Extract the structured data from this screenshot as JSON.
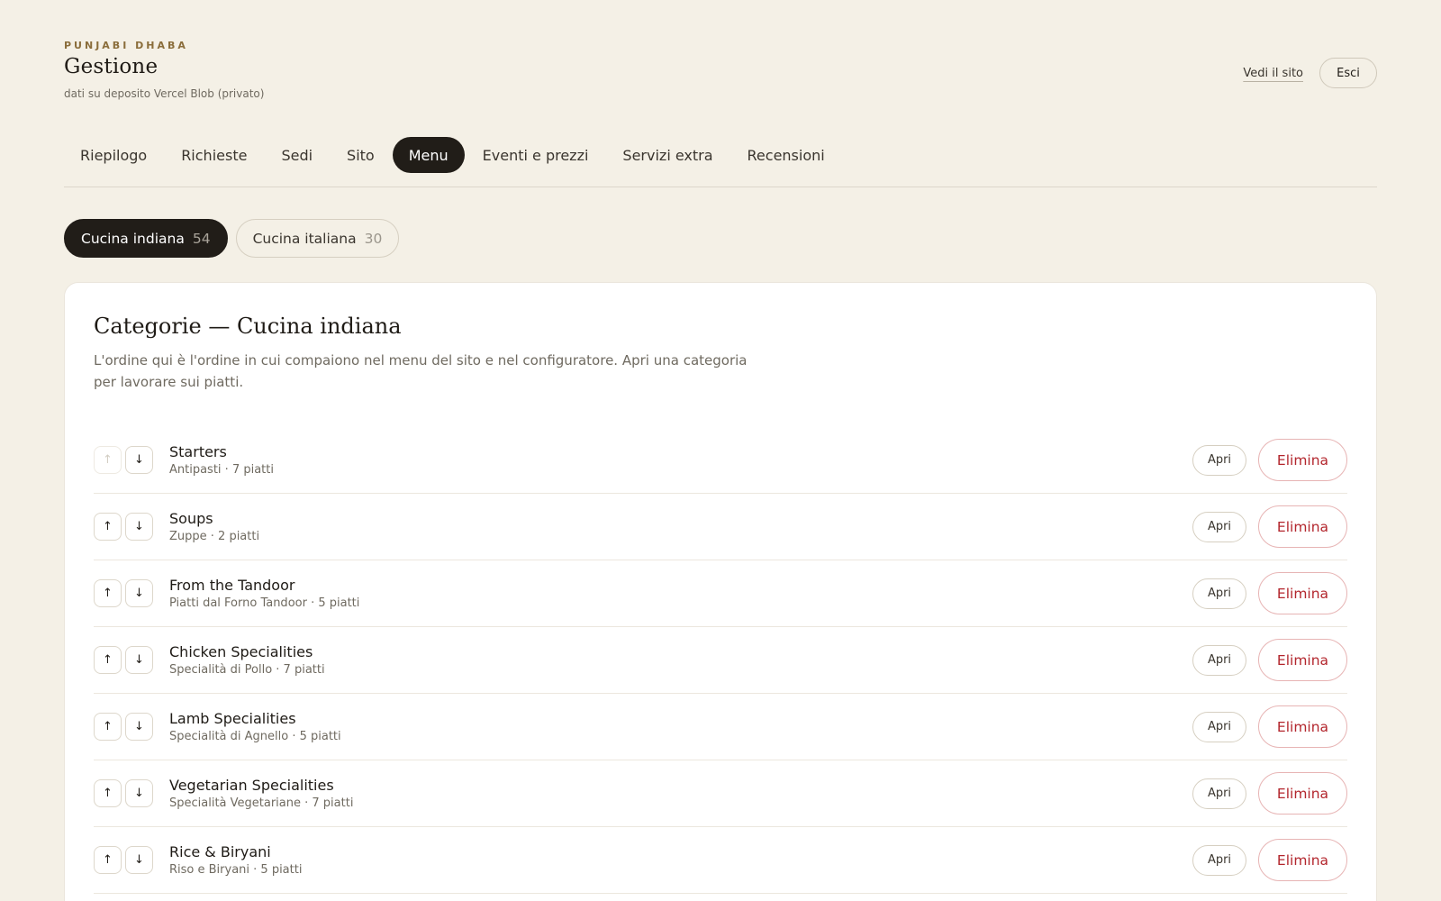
{
  "header": {
    "kicker": "PUNJABI DHABA",
    "title": "Gestione",
    "subtitle": "dati su deposito Vercel Blob (privato)",
    "view_site": "Vedi il sito",
    "logout": "Esci"
  },
  "nav": {
    "tabs": [
      {
        "label": "Riepilogo",
        "active": false
      },
      {
        "label": "Richieste",
        "active": false
      },
      {
        "label": "Sedi",
        "active": false
      },
      {
        "label": "Sito",
        "active": false
      },
      {
        "label": "Menu",
        "active": true
      },
      {
        "label": "Eventi e prezzi",
        "active": false
      },
      {
        "label": "Servizi extra",
        "active": false
      },
      {
        "label": "Recensioni",
        "active": false
      }
    ]
  },
  "kitchens": [
    {
      "label": "Cucina indiana",
      "count": "54",
      "active": true
    },
    {
      "label": "Cucina italiana",
      "count": "30",
      "active": false
    }
  ],
  "card": {
    "title": "Categorie — Cucina indiana",
    "description": "L'ordine qui è l'ordine in cui compaiono nel menu del sito e nel configuratore. Apri una categoria per lavorare sui piatti."
  },
  "actions": {
    "open": "Apri",
    "delete": "Elimina",
    "up_icon": "↑",
    "down_icon": "↓"
  },
  "categories": [
    {
      "name": "Starters",
      "sub": "Antipasti · 7 piatti",
      "first": true
    },
    {
      "name": "Soups",
      "sub": "Zuppe · 2 piatti",
      "first": false
    },
    {
      "name": "From the Tandoor",
      "sub": "Piatti dal Forno Tandoor · 5 piatti",
      "first": false
    },
    {
      "name": "Chicken Specialities",
      "sub": "Specialità di Pollo · 7 piatti",
      "first": false
    },
    {
      "name": "Lamb Specialities",
      "sub": "Specialità di Agnello · 5 piatti",
      "first": false
    },
    {
      "name": "Vegetarian Specialities",
      "sub": "Specialità Vegetariane · 7 piatti",
      "first": false
    },
    {
      "name": "Rice & Biryani",
      "sub": "Riso e Biryani · 5 piatti",
      "first": false
    }
  ],
  "colors": {
    "background": "#f4f0e6",
    "accent_dark": "#211d18",
    "danger": "#b3262d",
    "brand_gold": "#8a6d3b"
  }
}
